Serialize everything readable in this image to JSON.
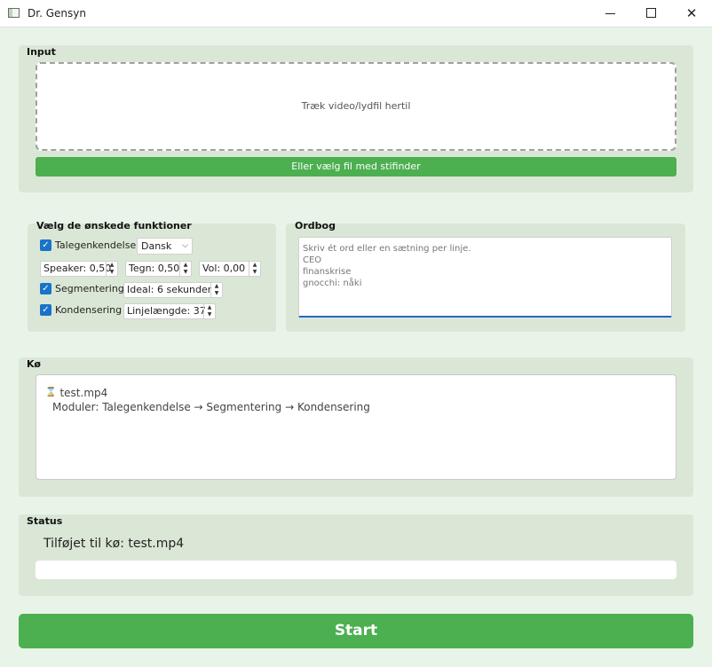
{
  "window": {
    "title": "Dr. Gensyn",
    "minimize_icon": "minimize-icon",
    "maximize_icon": "maximize-icon",
    "close_glyph": "✕"
  },
  "input": {
    "title": "Input",
    "drop_text": "Træk video/lydfil hertil",
    "browse_label": "Eller vælg fil med stifinder"
  },
  "functions": {
    "title": "Vælg de ønskede funktioner",
    "speech_label": "Talegenkendelse",
    "speech_checked": true,
    "language": "Dansk",
    "speaker": "Speaker: 0,50",
    "chars": "Tegn: 0,50",
    "vol": "Vol: 0,00",
    "segment_label": "Segmentering",
    "segment_checked": true,
    "ideal": "Ideal: 6 sekunder",
    "condense_label": "Kondensering",
    "condense_checked": true,
    "line_length": "Linjelængde: 37"
  },
  "dictionary": {
    "title": "Ordbog",
    "placeholder": "Skriv ét ord eller en sætning per linje.",
    "entries": "CEO\nfinanskrise\ngnocchi: nåki"
  },
  "queue": {
    "title": "Kø",
    "items": [
      {
        "file": "test.mp4",
        "status_icon": "hourglass-icon",
        "modules": "Moduler: Talegenkendelse → Segmentering → Kondensering"
      }
    ]
  },
  "status": {
    "title": "Status",
    "message": "Tilføjet til kø: test.mp4",
    "progress": 0
  },
  "start_label": "Start",
  "colors": {
    "accent_green": "#4caf50",
    "background": "#e8f4e8",
    "group_bg": "#dbe7d6",
    "checkbox_blue": "#1a73c9"
  }
}
